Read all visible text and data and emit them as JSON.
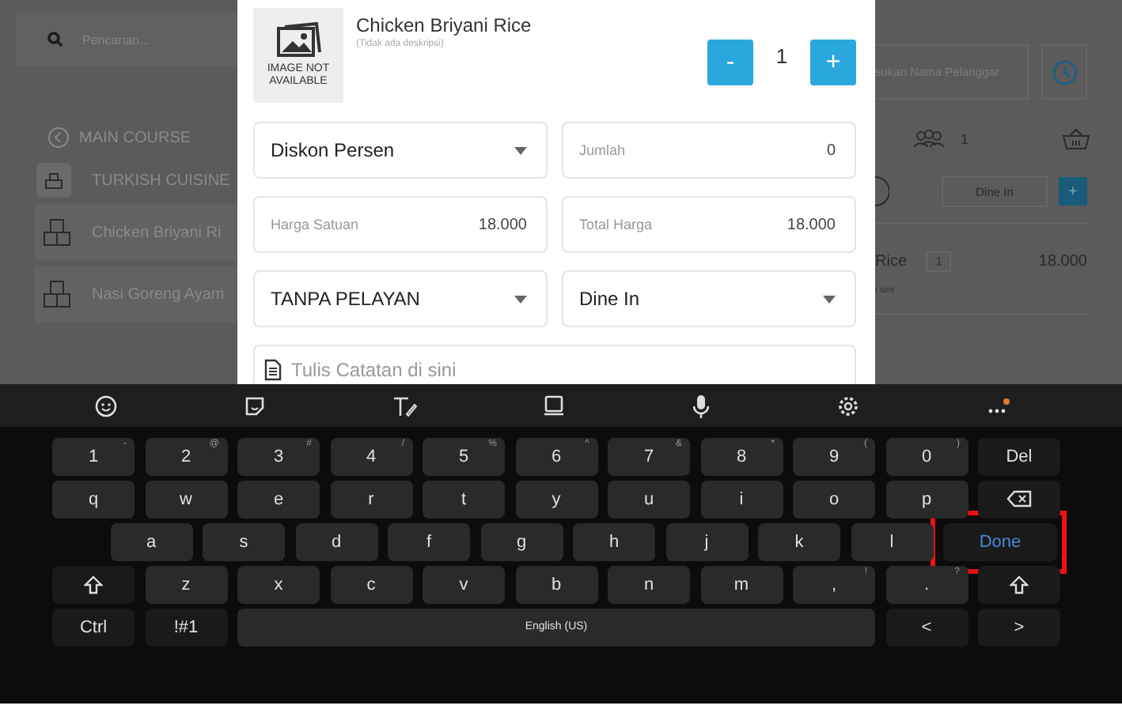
{
  "background": {
    "search": {
      "placeholder": "Pencarian..."
    },
    "category": "MAIN COURSE",
    "subcategory": "TURKISH CUISINE",
    "menu_items": [
      "Chicken Briyani Ri",
      "Nasi Goreng Ayam"
    ],
    "customer": {
      "placeholder": "sukan Nama Pelanggar"
    },
    "guests": "1",
    "order_type": "Dine In",
    "add": "+",
    "order_line": {
      "name": "Rice",
      "qty": "1",
      "price": "18.000",
      "note": "i sini"
    }
  },
  "dialog": {
    "image_text": "IMAGE NOT AVAILABLE",
    "title": "Chicken Briyani Rice",
    "description": "(Tidak ada deskripsi)",
    "minus": "-",
    "quantity": "1",
    "plus": "+",
    "fields": [
      {
        "kind": "select",
        "value": "Diskon Persen"
      },
      {
        "kind": "input",
        "label": "Jumlah",
        "value": "0"
      },
      {
        "kind": "input",
        "label": "Harga Satuan",
        "value": "18.000"
      },
      {
        "kind": "input",
        "label": "Total Harga",
        "value": "18.000"
      },
      {
        "kind": "select",
        "value": "TANPA PELAYAN"
      },
      {
        "kind": "select",
        "value": "Dine In"
      }
    ],
    "note": {
      "placeholder": "Tulis Catatan di sini"
    }
  },
  "keyboard": {
    "rows": [
      {
        "keys": [
          {
            "kind": "char",
            "label": "1",
            "hint": "-"
          },
          {
            "kind": "char",
            "label": "2",
            "hint": "@"
          },
          {
            "kind": "char",
            "label": "3",
            "hint": "#"
          },
          {
            "kind": "char",
            "label": "4",
            "hint": "/"
          },
          {
            "kind": "char",
            "label": "5",
            "hint": "%"
          },
          {
            "kind": "char",
            "label": "6",
            "hint": "^"
          },
          {
            "kind": "char",
            "label": "7",
            "hint": "&"
          },
          {
            "kind": "char",
            "label": "8",
            "hint": "*"
          },
          {
            "kind": "char",
            "label": "9",
            "hint": "("
          },
          {
            "kind": "char",
            "label": "0",
            "hint": ")"
          },
          {
            "kind": "fn",
            "label": "Del"
          }
        ]
      },
      {
        "keys": [
          {
            "kind": "char",
            "label": "q"
          },
          {
            "kind": "char",
            "label": "w"
          },
          {
            "kind": "char",
            "label": "e"
          },
          {
            "kind": "char",
            "label": "r"
          },
          {
            "kind": "char",
            "label": "t"
          },
          {
            "kind": "char",
            "label": "y"
          },
          {
            "kind": "char",
            "label": "u"
          },
          {
            "kind": "char",
            "label": "i"
          },
          {
            "kind": "char",
            "label": "o"
          },
          {
            "kind": "char",
            "label": "p"
          },
          {
            "kind": "backspace"
          }
        ]
      },
      {
        "keys": [
          {
            "kind": "char",
            "label": "a"
          },
          {
            "kind": "char",
            "label": "s"
          },
          {
            "kind": "char",
            "label": "d"
          },
          {
            "kind": "char",
            "label": "f"
          },
          {
            "kind": "char",
            "label": "g"
          },
          {
            "kind": "char",
            "label": "h"
          },
          {
            "kind": "char",
            "label": "j"
          },
          {
            "kind": "char",
            "label": "k"
          },
          {
            "kind": "char",
            "label": "l"
          },
          {
            "kind": "done",
            "label": "Done",
            "highlighted": true
          }
        ]
      },
      {
        "keys": [
          {
            "kind": "shift"
          },
          {
            "kind": "char",
            "label": "z"
          },
          {
            "kind": "char",
            "label": "x"
          },
          {
            "kind": "char",
            "label": "c"
          },
          {
            "kind": "char",
            "label": "v"
          },
          {
            "kind": "char",
            "label": "b"
          },
          {
            "kind": "char",
            "label": "n"
          },
          {
            "kind": "char",
            "label": "m"
          },
          {
            "kind": "char",
            "label": ",",
            "hint": "!"
          },
          {
            "kind": "char",
            "label": ".",
            "hint": "?"
          },
          {
            "kind": "shift"
          }
        ]
      },
      {
        "keys": [
          {
            "kind": "fn",
            "label": "Ctrl"
          },
          {
            "kind": "fn",
            "label": "!#1"
          },
          {
            "kind": "space",
            "label": "English (US)"
          },
          {
            "kind": "fn",
            "label": "<"
          },
          {
            "kind": "fn",
            "label": ">"
          }
        ]
      }
    ]
  }
}
